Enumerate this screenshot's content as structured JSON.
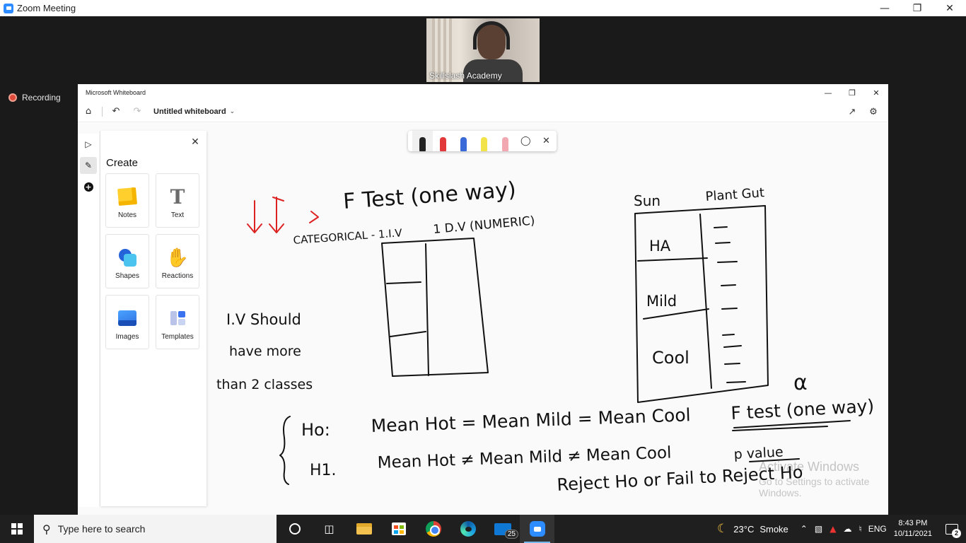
{
  "zoom": {
    "window_title": "Zoom Meeting",
    "participant_name": "Skillslash Academy",
    "recording_label": "Recording"
  },
  "whiteboard": {
    "app_title": "Microsoft Whiteboard",
    "document_title": "Untitled whiteboard",
    "create_panel": {
      "title": "Create",
      "items": [
        {
          "label": "Notes",
          "icon": "sticky-note-icon"
        },
        {
          "label": "Text",
          "icon": "text-icon"
        },
        {
          "label": "Shapes",
          "icon": "shapes-icon"
        },
        {
          "label": "Reactions",
          "icon": "thumbs-up-icon"
        },
        {
          "label": "Images",
          "icon": "image-icon"
        },
        {
          "label": "Templates",
          "icon": "templates-icon"
        }
      ]
    },
    "pens": [
      {
        "name": "black-pen",
        "color": "#222222",
        "selected": true
      },
      {
        "name": "red-pen",
        "color": "#e23a3a",
        "selected": false
      },
      {
        "name": "blue-pen",
        "color": "#3a6ad8",
        "selected": false
      },
      {
        "name": "highlighter",
        "color": "#f3e34a",
        "selected": false
      },
      {
        "name": "eraser",
        "color": "#f2a8b0",
        "selected": false
      }
    ],
    "ink_text": {
      "f_test": "F Test (one way)",
      "categorical": "CATEGORICAL - 1.I.V",
      "dv": "1 D.V (NUMERIC)",
      "iv_note_1": "I.V Should",
      "iv_note_2": "have more",
      "iv_note_3": "than 2 classes",
      "sun": "Sun",
      "plant": "Plant Gut",
      "hot": "HA",
      "mild": "Mild",
      "cool": "Cool",
      "h0_label": "Ho:",
      "h0_eq": "Mean Hot = Mean Mild = Mean Cool",
      "h1_label": "H1.",
      "h1_eq": "Mean Hot ≠ Mean Mild ≠ Mean Cool",
      "alpha": "α",
      "ftest_2": "F test (one way)",
      "pvalue": "p value",
      "reject": "Reject Ho  or Fail to Reject Ho"
    },
    "watermark": {
      "line1": "Activate Windows",
      "line2": "Go to Settings to activate Windows."
    }
  },
  "taskbar": {
    "search_placeholder": "Type here to search",
    "mail_badge": "25",
    "weather_temp": "23°C",
    "weather_desc": "Smoke",
    "language": "ENG",
    "time": "8:43 PM",
    "date": "10/11/2021",
    "notification_count": "2"
  }
}
